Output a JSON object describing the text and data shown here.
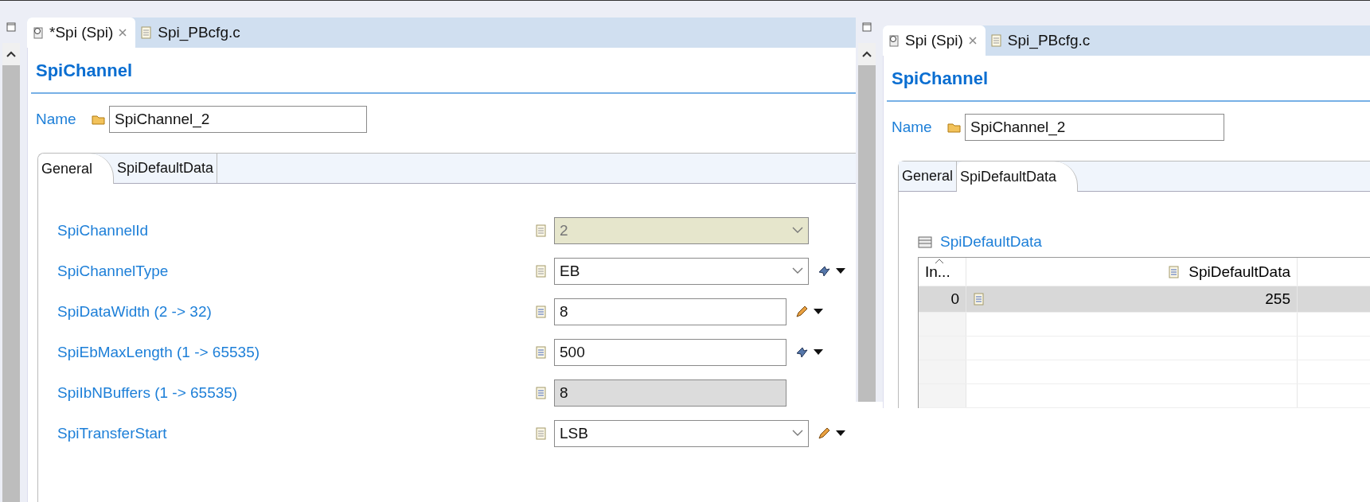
{
  "editors": [
    {
      "tabs": [
        {
          "label": "*Spi (Spi)",
          "selected": true,
          "closable": true
        },
        {
          "label": "Spi_PBcfg.c",
          "selected": false,
          "closable": false
        }
      ],
      "title": "SpiChannel",
      "name_label": "Name",
      "name_value": "SpiChannel_2",
      "page_tabs": [
        {
          "label": "General",
          "selected": true
        },
        {
          "label": "SpiDefaultData",
          "selected": false
        }
      ],
      "parameters": [
        {
          "label": "SpiChannelId",
          "value": "2",
          "kind": "combo",
          "disabled": true,
          "calculated": false,
          "editable": false
        },
        {
          "label": "SpiChannelType",
          "value": "EB",
          "kind": "combo",
          "disabled": false,
          "calculated": true,
          "editable": false
        },
        {
          "label": "SpiDataWidth (2 -> 32)",
          "value": "8",
          "kind": "text",
          "disabled": false,
          "calculated": false,
          "editable": true
        },
        {
          "label": "SpiEbMaxLength (1 -> 65535)",
          "value": "500",
          "kind": "text",
          "disabled": false,
          "calculated": true,
          "editable": false
        },
        {
          "label": "SpiIbNBuffers (1 -> 65535)",
          "value": "8",
          "kind": "text",
          "disabled": true,
          "calculated": false,
          "editable": false
        },
        {
          "label": "SpiTransferStart",
          "value": "LSB",
          "kind": "combo",
          "disabled": false,
          "calculated": false,
          "editable": true
        }
      ]
    },
    {
      "tabs": [
        {
          "label": "Spi (Spi)",
          "selected": true,
          "closable": true
        },
        {
          "label": "Spi_PBcfg.c",
          "selected": false,
          "closable": false
        }
      ],
      "title": "SpiChannel",
      "name_label": "Name",
      "name_value": "SpiChannel_2",
      "page_tabs": [
        {
          "label": "General",
          "selected": false
        },
        {
          "label": "SpiDefaultData",
          "selected": true
        }
      ],
      "table": {
        "title": "SpiDefaultData",
        "columns": [
          "In...",
          "SpiDefaultData"
        ],
        "rows": [
          {
            "cells": [
              "0",
              "255"
            ],
            "selected": true
          }
        ]
      }
    }
  ]
}
